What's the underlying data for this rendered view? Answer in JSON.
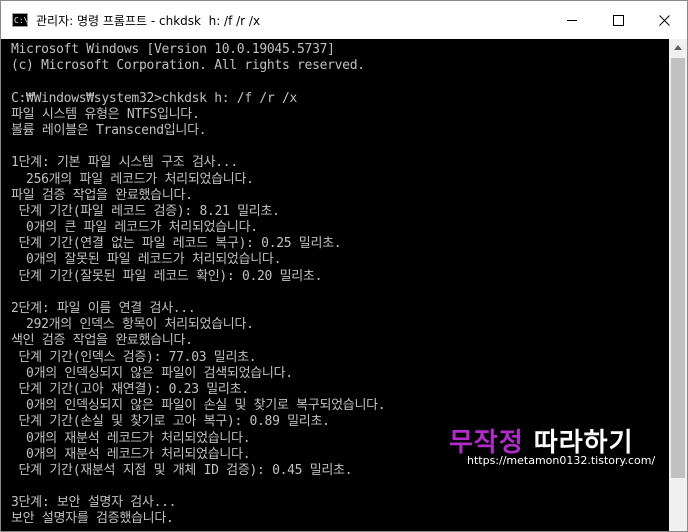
{
  "window": {
    "title": "관리자: 명령 프롬프트 - chkdsk  h: /f /r /x",
    "icon_label": "C:\\",
    "controls": [
      "minimize-icon",
      "maximize-icon",
      "close-icon"
    ]
  },
  "console": {
    "lines": [
      "Microsoft Windows [Version 10.0.19045.5737]",
      "(c) Microsoft Corporation. All rights reserved.",
      "",
      "C:₩Windows₩system32>chkdsk h: /f /r /x",
      "파일 시스템 유형은 NTFS입니다.",
      "볼륨 레이블은 Transcend입니다.",
      "",
      "1단계: 기본 파일 시스템 구조 검사...",
      "  256개의 파일 레코드가 처리되었습니다.",
      "파일 검증 작업을 완료했습니다.",
      " 단계 기간(파일 레코드 검증): 8.21 밀리초.",
      "  0개의 큰 파일 레코드가 처리되었습니다.",
      " 단계 기간(연결 없는 파일 레코드 복구): 0.25 밀리초.",
      "  0개의 잘못된 파일 레코드가 처리되었습니다.",
      " 단계 기간(잘못된 파일 레코드 확인): 0.20 밀리초.",
      "",
      "2단계: 파일 이름 연결 검사...",
      "  292개의 인덱스 항목이 처리되었습니다.",
      "색인 검증 작업을 완료했습니다.",
      " 단계 기간(인덱스 검증): 77.03 밀리초.",
      "  0개의 인덱싱되지 않은 파일이 검색되었습니다.",
      " 단계 기간(고아 재연결): 0.23 밀리초.",
      "  0개의 인덱싱되지 않은 파일이 손실 및 찾기로 복구되었습니다.",
      " 단계 기간(손실 및 찾기로 고아 복구): 0.89 밀리초.",
      "  0개의 재분석 레코드가 처리되었습니다.",
      "  0개의 재분석 레코드가 처리되었습니다.",
      " 단계 기간(재분석 지점 및 개체 ID 검증): 0.45 밀리초.",
      "",
      "3단계: 보안 설명자 검사...",
      "보안 설명자를 검증했습니다."
    ]
  },
  "watermark": {
    "title_part1": "무작정",
    "title_part2": "따라하기",
    "url": "https://metamon0132.tistory.com/"
  },
  "colors": {
    "console_bg": "#000000",
    "console_fg": "#c0c0c0",
    "watermark_accent": "#b02cc8"
  }
}
